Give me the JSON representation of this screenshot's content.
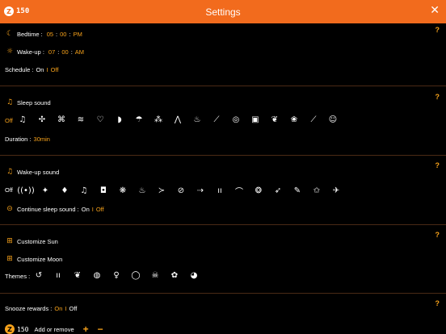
{
  "header": {
    "title": "Settings",
    "coins": "150",
    "close": "✕"
  },
  "help": "?",
  "bedtime": {
    "label": "Bedtime :",
    "h": "05",
    "m": "00",
    "ampm": "PM"
  },
  "wakeup": {
    "label": "Wake-up :",
    "h": "07",
    "m": "00",
    "ampm": "AM"
  },
  "schedule": {
    "label": "Schedule :",
    "on": "On",
    "sep": "I",
    "off": "Off"
  },
  "sleep_sound": {
    "label": "Sleep sound",
    "off": "Off",
    "icons": [
      "harp-icon",
      "fan-icon",
      "hairdryer-icon",
      "waves-icon",
      "heart-icon",
      "whale-icon",
      "rain-cloud-icon",
      "wind-icon",
      "birds-icon",
      "lantern-icon",
      "gong-icon",
      "bell-icon",
      "washing-machine-icon",
      "deer-icon",
      "lotus-icon",
      "flute-icon",
      "monk-icon"
    ],
    "glyphs": [
      "♫",
      "✣",
      "⌘",
      "≋",
      "♡",
      "◗",
      "☂",
      "⁂",
      "⋀",
      "♨",
      "⟋",
      "◎",
      "▣",
      "❦",
      "❀",
      "⟋",
      "☺"
    ],
    "duration_label": "Duration :",
    "duration_value": "30min"
  },
  "wakeup_sound": {
    "label": "Wake-up sound",
    "off": "Off",
    "icons": [
      "signal-icon",
      "bird-icon",
      "foot-icon",
      "music-note-icon",
      "binoculars-icon",
      "bug-icon",
      "pot-icon",
      "bird-fly-icon",
      "clock-icon",
      "trumpet-icon",
      "candles-icon",
      "witch-hat-icon",
      "rabbit-icon",
      "rocket-icon",
      "guitar-icon",
      "jester-icon",
      "skater-icon"
    ],
    "glyphs": [
      "((•))",
      "✦",
      "♦",
      "♫",
      "◘",
      "❋",
      "♨",
      "≻",
      "⊘",
      "⇢",
      "ıı",
      "⌒",
      "❂",
      "➶",
      "✎",
      "✩",
      "✈"
    ],
    "continue_label": "Continue sleep sound :",
    "on": "On",
    "sep": "I",
    "off2": "Off"
  },
  "customize": {
    "sun": "Customize Sun",
    "moon": "Customize Moon"
  },
  "themes": {
    "label": "Themes :",
    "icons": [
      "reset-icon",
      "candles-theme-icon",
      "deer-theme-icon",
      "egg-theme-icon",
      "runner-theme-icon",
      "planet-theme-icon",
      "skull-theme-icon",
      "tree-theme-icon",
      "ghost-theme-icon"
    ],
    "glyphs": [
      "↺",
      "ıı",
      "❦",
      "◍",
      "♀",
      "◯",
      "☠",
      "✿",
      "◕"
    ]
  },
  "snooze": {
    "label": "Snooze rewards :",
    "on": "On",
    "sep": "I",
    "off": "Off"
  },
  "bottom": {
    "coins": "150",
    "add_remove": "Add or remove",
    "plus": "+",
    "minus": "−"
  }
}
